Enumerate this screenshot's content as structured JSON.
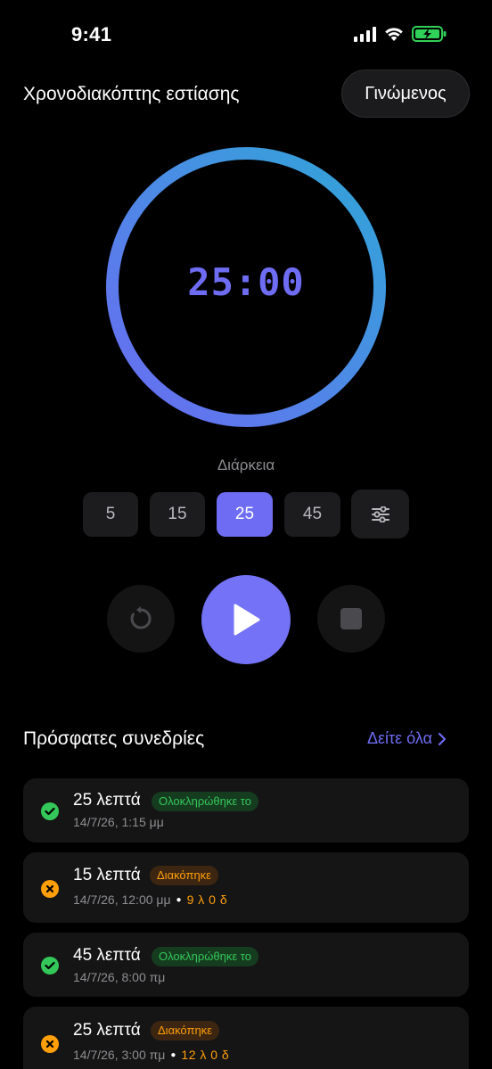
{
  "status_bar": {
    "time": "9:41",
    "icons": [
      "cellular-signal-icon",
      "wifi-icon",
      "battery-charging-icon"
    ],
    "battery_color": "#30d158"
  },
  "header": {
    "title": "Χρονοδιακόπτης εστίασης",
    "done_label": "Γινώμενος"
  },
  "timer": {
    "display": "25:00",
    "accent_color": "#6e6cf2",
    "ring_gradient": [
      "#3aa0d8",
      "#6a6cf2"
    ]
  },
  "duration": {
    "label": "Διάρκεια",
    "options": [
      "5",
      "15",
      "25",
      "45"
    ],
    "selected": "25",
    "custom_icon": "sliders-icon"
  },
  "controls": {
    "reset_icon": "reset-icon",
    "play_icon": "play-icon",
    "stop_icon": "stop-icon"
  },
  "sessions": {
    "title": "Πρόσφατες συνεδρίες",
    "see_all": "Δείτε όλα",
    "items": [
      {
        "title": "25 λεπτά",
        "status": "Ολοκληρώθηκε το",
        "kind": "done",
        "timestamp": "14/7/26, 1:15 μμ",
        "remaining": ""
      },
      {
        "title": "15 λεπτά",
        "status": "Διακόπηκε",
        "kind": "stop",
        "timestamp": "14/7/26, 12:00 μμ",
        "remaining": "9 λ 0 δ"
      },
      {
        "title": "45 λεπτά",
        "status": "Ολοκληρώθηκε το",
        "kind": "done",
        "timestamp": "14/7/26, 8:00 πμ",
        "remaining": ""
      },
      {
        "title": "25 λεπτά",
        "status": "Διακόπηκε",
        "kind": "stop",
        "timestamp": "14/7/26, 3:00 πμ",
        "remaining": "12 λ 0 δ"
      }
    ]
  }
}
